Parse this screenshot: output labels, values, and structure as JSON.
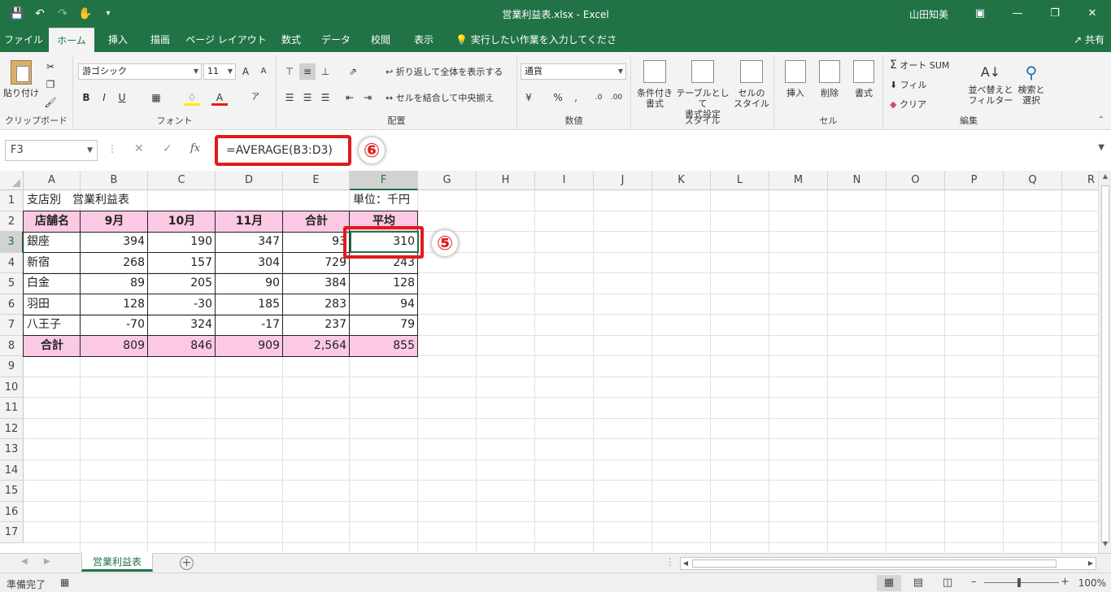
{
  "window": {
    "title": "営業利益表.xlsx  -  Excel",
    "user": "山田知美",
    "share": "共有"
  },
  "tabs": [
    {
      "label": "ファイル"
    },
    {
      "label": "ホーム"
    },
    {
      "label": "挿入"
    },
    {
      "label": "描画"
    },
    {
      "label": "ページ レイアウト"
    },
    {
      "label": "数式"
    },
    {
      "label": "データ"
    },
    {
      "label": "校閲"
    },
    {
      "label": "表示"
    },
    {
      "label": "実行したい作業を入力してください"
    }
  ],
  "ribbon": {
    "clipboard": {
      "label": "クリップボード",
      "paste": "貼り付け"
    },
    "font": {
      "label": "フォント",
      "name": "游ゴシック",
      "size": "11"
    },
    "alignment": {
      "label": "配置",
      "wrap": "折り返して全体を表示する",
      "merge": "セルを結合して中央揃え"
    },
    "number": {
      "label": "数値",
      "format": "通貨"
    },
    "styles": {
      "label": "スタイル",
      "cond1": "条件付き",
      "cond2": "書式",
      "table1": "テーブルとして",
      "table2": "書式設定",
      "cell1": "セルの",
      "cell2": "スタイル"
    },
    "cells": {
      "label": "セル",
      "insert": "挿入",
      "delete": "削除",
      "format": "書式"
    },
    "editing": {
      "label": "編集",
      "autosum": "オート SUM",
      "fill": "フィル",
      "clear": "クリア",
      "sort1": "並べ替えと",
      "sort2": "フィルター",
      "find1": "検索と",
      "find2": "選択"
    }
  },
  "formula_bar": {
    "name_box": "F3",
    "formula": "=AVERAGE(B3:D3)",
    "callout": "⑥"
  },
  "callout_cell": "⑤",
  "columns": [
    "A",
    "B",
    "C",
    "D",
    "E",
    "F",
    "G",
    "H",
    "I",
    "J",
    "K",
    "L",
    "M",
    "N",
    "O",
    "P",
    "Q",
    "R"
  ],
  "rows": [
    "1",
    "2",
    "3",
    "4",
    "5",
    "6",
    "7",
    "8",
    "9",
    "10",
    "11",
    "12",
    "13",
    "14",
    "15",
    "16",
    "17"
  ],
  "sheet": {
    "A1": "支店別　営業利益表",
    "F1": "単位：千円",
    "headers": [
      "店舗名",
      "9月",
      "10月",
      "11月",
      "合計",
      "平均"
    ],
    "data": [
      [
        "銀座",
        "394",
        "190",
        "347",
        "93",
        "310"
      ],
      [
        "新宿",
        "268",
        "157",
        "304",
        "729",
        "243"
      ],
      [
        "白金",
        "89",
        "205",
        "90",
        "384",
        "128"
      ],
      [
        "羽田",
        "128",
        "-30",
        "185",
        "283",
        "94"
      ],
      [
        "八王子",
        "-70",
        "324",
        "-17",
        "237",
        "79"
      ]
    ],
    "total": [
      "合計",
      "809",
      "846",
      "909",
      "2,564",
      "855"
    ]
  },
  "sheet_tab": "営業利益表",
  "status": {
    "ready": "準備完了",
    "zoom": "100%"
  },
  "colors": {
    "accent": "#217346",
    "highlight_red": "#e01b1b",
    "header_pink": "#fbc9e3"
  }
}
